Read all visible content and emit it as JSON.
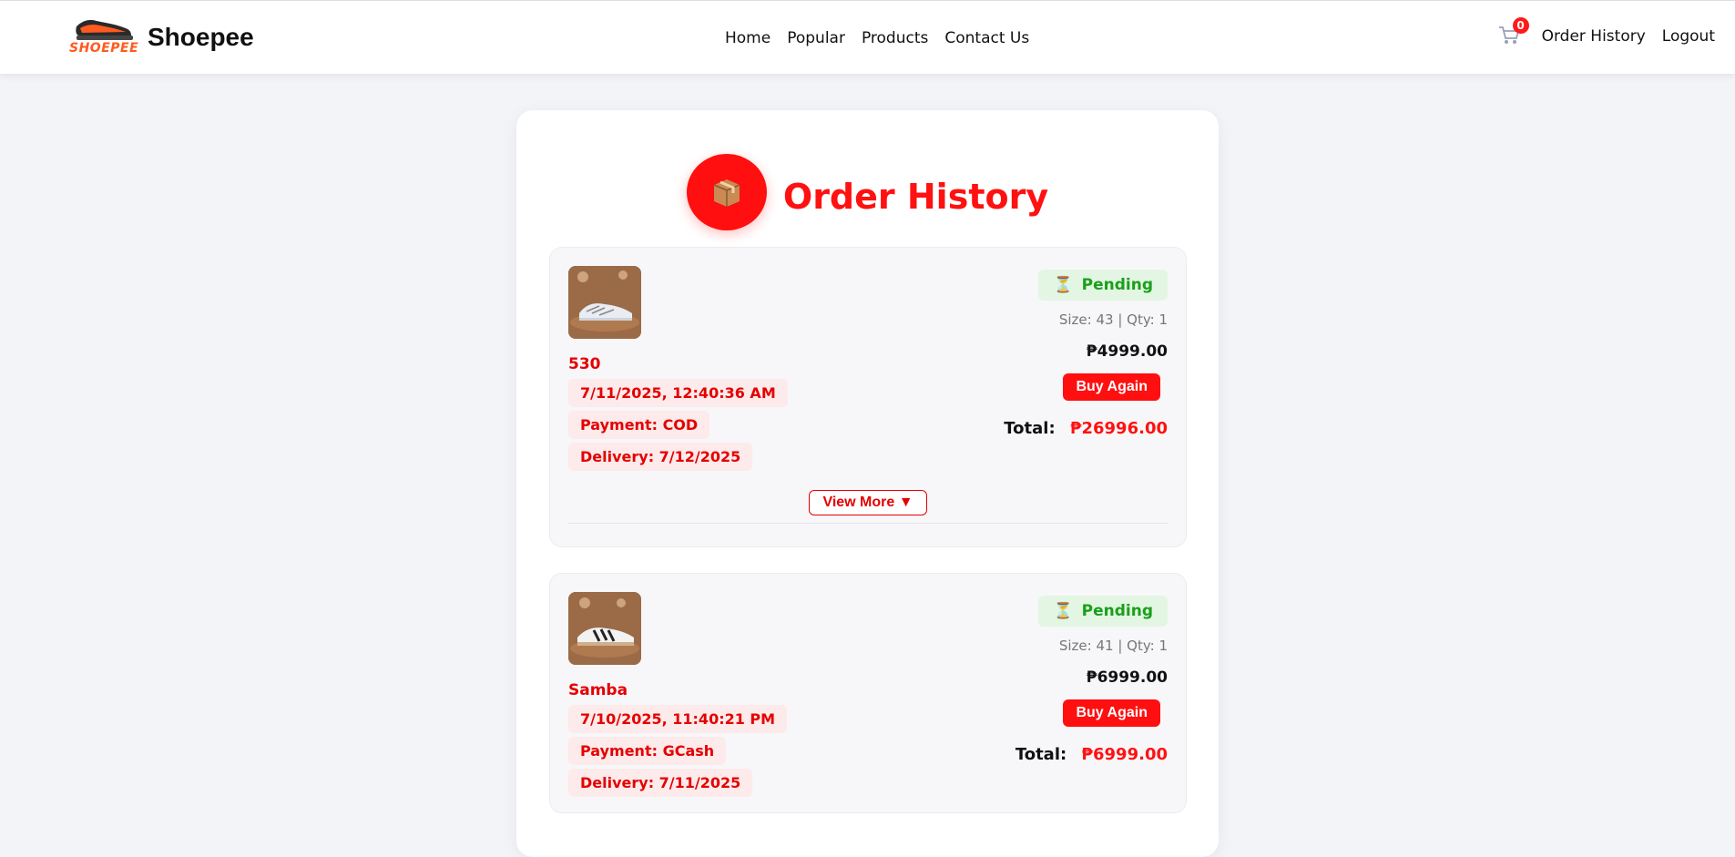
{
  "brand": {
    "logo_text": "SHOEPEE",
    "name": "Shoepee"
  },
  "nav": [
    "Home",
    "Popular",
    "Products",
    "Contact Us"
  ],
  "right_nav": {
    "cart_count": "0",
    "order_history": "Order History",
    "logout": "Logout"
  },
  "page": {
    "title": "Order History",
    "title_icon": "package-icon"
  },
  "orders": [
    {
      "product_name": "530",
      "datetime": "7/11/2025, 12:40:36 AM",
      "payment": "Payment: COD",
      "delivery": "Delivery: 7/12/2025",
      "status": "Pending",
      "status_icon": "hourglass-icon",
      "size_qty": "Size: 43 | Qty: 1",
      "price": "₱4999.00",
      "buy_again": "Buy Again",
      "total_label": "Total:",
      "total_amount": "₱26996.00",
      "view_more": "View More ▼"
    },
    {
      "product_name": "Samba",
      "datetime": "7/10/2025, 11:40:21 PM",
      "payment": "Payment: GCash",
      "delivery": "Delivery: 7/11/2025",
      "status": "Pending",
      "status_icon": "hourglass-icon",
      "size_qty": "Size: 41 | Qty: 1",
      "price": "₱6999.00",
      "buy_again": "Buy Again",
      "total_label": "Total:",
      "total_amount": "₱6999.00"
    }
  ],
  "colors": {
    "accent": "#ff1111",
    "status_green": "#1aa01a",
    "status_bg": "#e3f6e3",
    "pill_bg": "#fdeaea"
  }
}
